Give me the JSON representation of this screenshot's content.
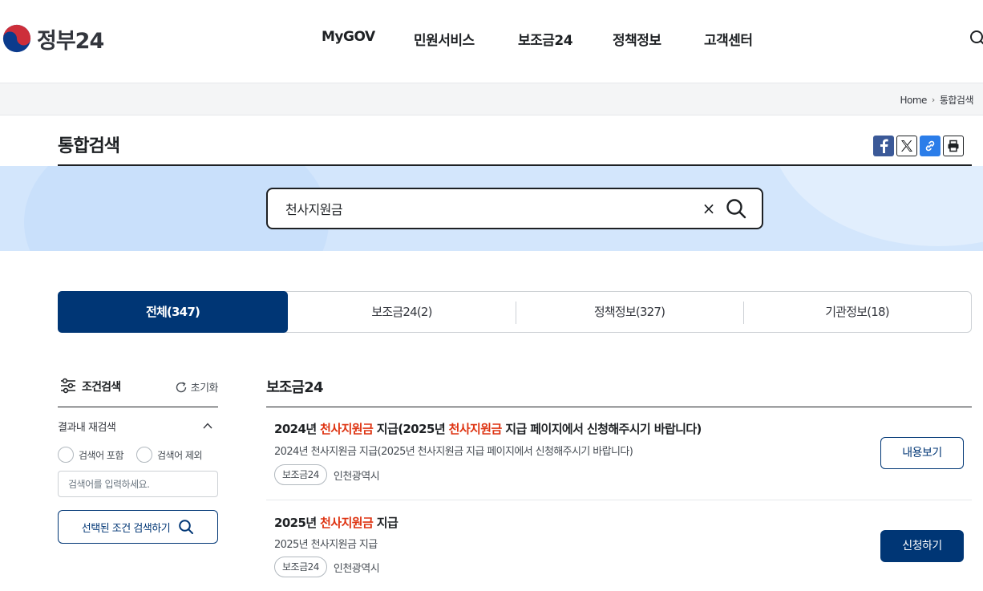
{
  "header": {
    "logo_text": "정부24",
    "nav": [
      "MyGOV",
      "민원서비스",
      "보조금24",
      "정책정보",
      "고객센터"
    ]
  },
  "breadcrumb": {
    "home": "Home",
    "current": "통합검색"
  },
  "page": {
    "title": "통합검색"
  },
  "search": {
    "value": "천사지원금",
    "clear_label": "×"
  },
  "tabs": [
    {
      "label": "전체(347)",
      "active": true
    },
    {
      "label": "보조금24(2)"
    },
    {
      "label": "정책정보(327)"
    },
    {
      "label": "기관정보(18)"
    }
  ],
  "filter": {
    "title": "조건검색",
    "reset_label": "초기화",
    "sub_title": "결과내 재검색",
    "radio_include": "검색어 포함",
    "radio_exclude": "검색어 제외",
    "input_placeholder": "검색어를 입력하세요.",
    "submit_label": "선택된 조건 검색하기"
  },
  "results": {
    "section_title": "보조금24",
    "items": [
      {
        "title_parts": [
          "2024년 ",
          "천사지원금",
          " 지급(2025년 ",
          "천사지원금",
          " 지급 페이지에서 신청해주시기 바랍니다)"
        ],
        "desc": "2024년 천사지원금 지급(2025년 천사지원금 지급 페이지에서 신청해주시기 바랍니다)",
        "badge": "보조금24",
        "org": "인천광역시",
        "button": "내용보기"
      },
      {
        "title_parts": [
          "2025년 ",
          "천사지원금",
          " 지급"
        ],
        "desc": "2025년 천사지원금 지급",
        "badge": "보조금24",
        "org": "인천광역시",
        "button": "신청하기"
      }
    ]
  },
  "colors": {
    "primary": "#003675",
    "highlight": "#de3412",
    "band": "#d3e6fc"
  }
}
